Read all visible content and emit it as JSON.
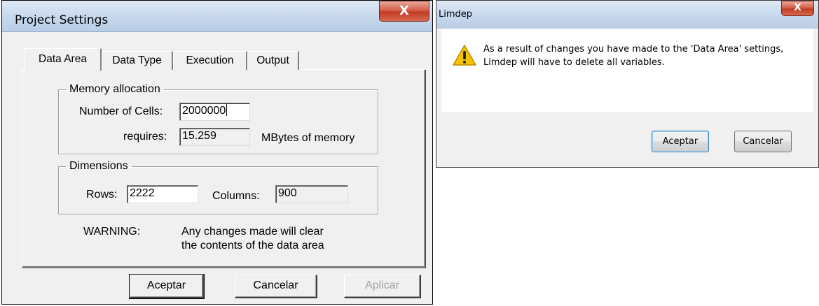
{
  "project_settings": {
    "title": "Project Settings",
    "close_glyph": "X",
    "tabs": [
      {
        "label": "Data Area",
        "active": true
      },
      {
        "label": "Data Type",
        "active": false
      },
      {
        "label": "Execution",
        "active": false
      },
      {
        "label": "Output",
        "active": false
      }
    ],
    "memory_allocation": {
      "legend": "Memory allocation",
      "cells_label": "Number of Cells:",
      "cells_value": "2000000",
      "requires_label": "requires:",
      "requires_value": "15.259",
      "requires_unit": "MBytes of memory"
    },
    "dimensions": {
      "legend": "Dimensions",
      "rows_label": "Rows:",
      "rows_value": "2222",
      "columns_label": "Columns:",
      "columns_value": "900"
    },
    "warning": {
      "label": "WARNING:",
      "line1": "Any changes made will clear",
      "line2": "the contents of the data area"
    },
    "buttons": {
      "ok": "Aceptar",
      "cancel": "Cancelar",
      "apply": "Aplicar"
    }
  },
  "limdep_dialog": {
    "title": "Limdep",
    "close_glyph": "X",
    "icon": "warning-icon",
    "message_line1": "As a result of changes you have made to the 'Data Area' settings,",
    "message_line2": "Limdep will have to delete all variables.",
    "buttons": {
      "ok": "Aceptar",
      "cancel": "Cancelar"
    }
  },
  "colors": {
    "titlebar": "#c8d9ee",
    "close_button": "#c23b22",
    "dialog_bg": "#f0f0f0",
    "warning_yellow": "#f5c400"
  }
}
